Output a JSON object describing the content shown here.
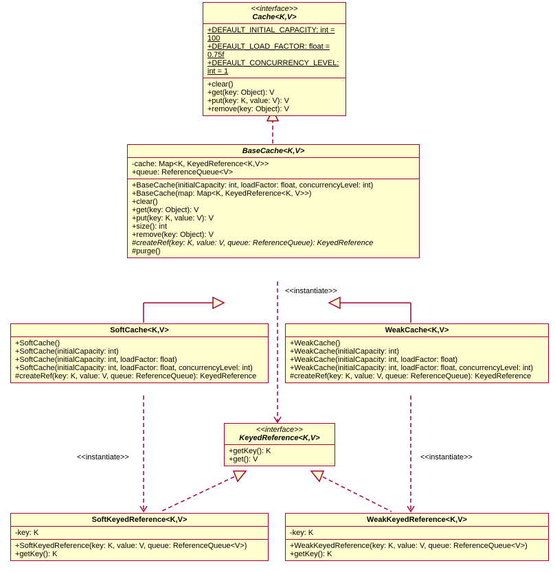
{
  "cache": {
    "stereo": "<<interface>>",
    "name": "Cache<K,V>",
    "attrs": [
      "+DEFAULT_INITIAL_CAPACITY: int = 100",
      "+DEFAULT_LOAD_FACTOR: float = 0.75f",
      "+DEFAULT_CONCURRENCY_LEVEL: int = 1"
    ],
    "ops": [
      "+clear()",
      "+get(key: Object): V",
      "+put(key: K, value: V): V",
      "+remove(key: Object): V"
    ]
  },
  "base": {
    "name": "BaseCache<K,V>",
    "attrs": [
      "-cache: Map<K, KeyedReference<K,V>>",
      "+queue: ReferenceQueue<V>"
    ],
    "ops": [
      "+BaseCache(initialCapacity: int, loadFactor: float, concurrencyLevel: int)",
      "+BaseCache(map: Map<K, KeyedReference<K, V>>)",
      "+clear()",
      "+get(key: Object): V",
      "+put(key: K, value: V): V",
      "+size(): int",
      "+remove(key: Object): V",
      "#createRef(key: K, value: V, queue: ReferenceQueue): KeyedReference",
      "#purge()"
    ]
  },
  "soft": {
    "name": "SoftCache<K,V>",
    "ops": [
      "+SoftCache()",
      "+SoftCache(initialCapacity: int)",
      "+SoftCache(initialCapacity: int, loadFactor: float)",
      "+SoftCache(initialCapacity: int, loadFactor: float, concurrencyLevel: int)",
      "#createRef(key: K, value: V, queue: ReferenceQueue): KeyedReference"
    ]
  },
  "weak": {
    "name": "WeakCache<K,V>",
    "ops": [
      "+WeakCache()",
      "+WeakCache(initialCapacity: int)",
      "+WeakCache(initialCapacity: int, loadFactor: float)",
      "+WeakCache(initialCapacity: int, loadFactor: float, concurrencyLevel: int)",
      "#createRef(key: K, value: V, queue: ReferenceQueue): KeyedReference"
    ]
  },
  "keyed": {
    "stereo": "<<interface>>",
    "name": "KeyedReference<K,V>",
    "ops": [
      "+getKey(): K",
      "+get(): V"
    ]
  },
  "softref": {
    "name": "SoftKeyedReference<K,V>",
    "attrs": [
      "-key: K"
    ],
    "ops": [
      "+SoftKeyedReference(key: K, value: V, queue: ReferenceQueue<V>)",
      "+getKey(): K"
    ]
  },
  "weakref": {
    "name": "WeakKeyedReference<K,V>",
    "attrs": [
      "-key: K"
    ],
    "ops": [
      "+WeakKeyedReference(key: K, value: V, queue: ReferenceQueue<V>)",
      "+getKey(): K"
    ]
  },
  "inst": "<<instantiate>>"
}
